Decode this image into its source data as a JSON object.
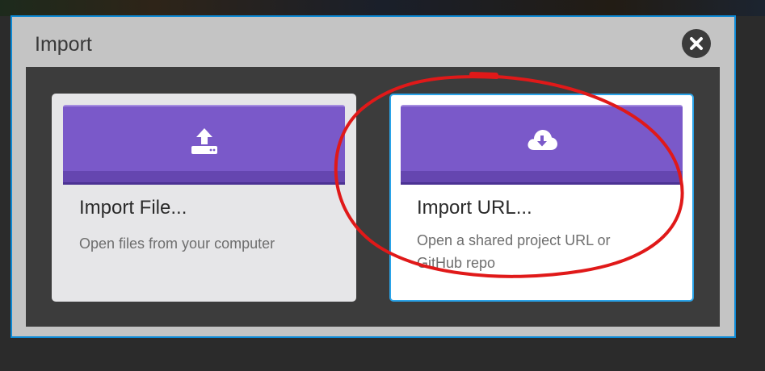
{
  "dialog": {
    "title": "Import",
    "close_icon": "close-icon"
  },
  "cards": {
    "file": {
      "icon": "upload-icon",
      "title": "Import File...",
      "description": "Open files from your computer"
    },
    "url": {
      "icon": "cloud-download-icon",
      "title": "Import URL...",
      "description": "Open a shared project URL or GitHub repo"
    }
  },
  "colors": {
    "accent_purple": "#7a59c9",
    "selection_blue": "#2aa3e8",
    "annotation_red": "#e01919"
  }
}
